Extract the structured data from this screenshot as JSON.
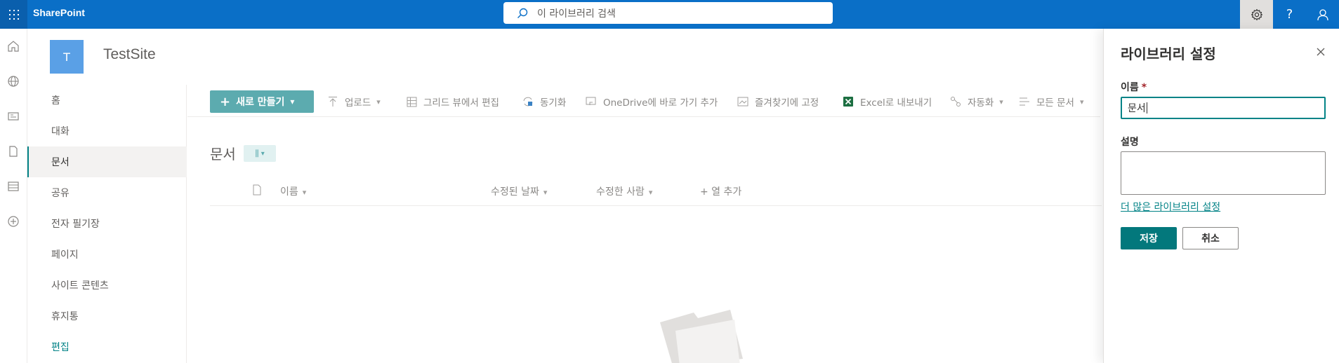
{
  "suitebar": {
    "app_name": "SharePoint",
    "search_placeholder": "이 라이브러리 검색",
    "icons": [
      "waffle-icon",
      "search-icon",
      "gear-icon",
      "help-icon",
      "person-icon"
    ],
    "help_label": "?"
  },
  "appbar": {
    "icons": [
      "home-icon",
      "globe-icon",
      "news-icon",
      "file-icon",
      "list-icon",
      "add-circle-icon"
    ]
  },
  "site": {
    "logo_letter": "T",
    "title": "TestSite"
  },
  "leftnav": {
    "items": [
      {
        "label": "홈"
      },
      {
        "label": "대화"
      },
      {
        "label": "문서",
        "selected": true
      },
      {
        "label": "공유"
      },
      {
        "label": "전자 필기장"
      },
      {
        "label": "페이지"
      },
      {
        "label": "사이트 콘텐츠"
      },
      {
        "label": "휴지통"
      },
      {
        "label": "편집"
      }
    ]
  },
  "commandbar": {
    "new_label": "새로 만들기",
    "upload_label": "업로드",
    "grid_edit_label": "그리드 뷰에서 편집",
    "sync_label": "동기화",
    "onedrive_label": "OneDrive에 바로 가기 추가",
    "pin_label": "즐겨찾기에 고정",
    "excel_label": "Excel로 내보내기",
    "automate_label": "자동화",
    "view_label": "모든 문서"
  },
  "library": {
    "title": "문서",
    "columns": {
      "name": "이름",
      "modified": "수정된 날짜",
      "modified_by": "수정한 사람",
      "add_column": "+ 열 추가"
    }
  },
  "panel": {
    "title": "라이브러리 설정",
    "name_label": "이름",
    "required_mark": "*",
    "name_value": "문서",
    "description_label": "설명",
    "description_value": "",
    "more_settings_link": "더 많은 라이브러리 설정",
    "save_label": "저장",
    "cancel_label": "취소"
  },
  "colors": {
    "suitebar": "#0a6fc7",
    "accent": "#03787c",
    "new_button": "#5cabaf"
  }
}
